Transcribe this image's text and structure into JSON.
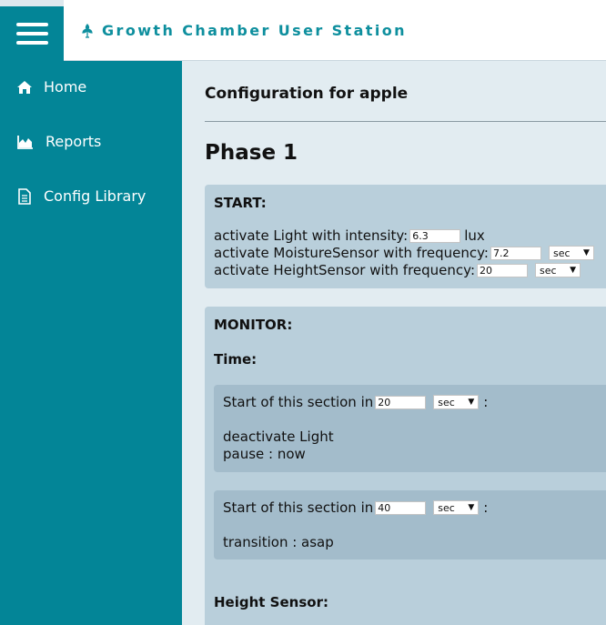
{
  "header": {
    "title": "Growth Chamber User Station"
  },
  "sidebar": {
    "items": [
      {
        "label": "Home",
        "icon": "home-icon"
      },
      {
        "label": "Reports",
        "icon": "area-chart-icon"
      },
      {
        "label": "Config Library",
        "icon": "file-icon"
      }
    ]
  },
  "main": {
    "title": "Configuration for apple",
    "phase": "Phase 1",
    "start": {
      "heading": "START:",
      "light_prefix": "activate Light with intensity:",
      "light_value": "6.3",
      "light_unit": "lux",
      "moisture_prefix": "activate MoistureSensor with frequency:",
      "moisture_value": "7.2",
      "moisture_unit": "sec",
      "height_prefix": "activate HeightSensor with frequency:",
      "height_value": "20",
      "height_unit": "sec"
    },
    "monitor": {
      "heading": "MONITOR:",
      "time_heading": "Time:",
      "section_prefix": "Start of this section in",
      "colon": ":",
      "sections": [
        {
          "value": "20",
          "unit": "sec",
          "line1": "deactivate Light",
          "line2": "pause : now"
        },
        {
          "value": "40",
          "unit": "sec",
          "line1": "transition : asap"
        }
      ],
      "height_heading": "Height Sensor:"
    }
  },
  "colors": {
    "sidebar": "#038597",
    "brand": "#0e8f9e",
    "card": "#b9cfdb",
    "subcard": "#a3bccb"
  }
}
